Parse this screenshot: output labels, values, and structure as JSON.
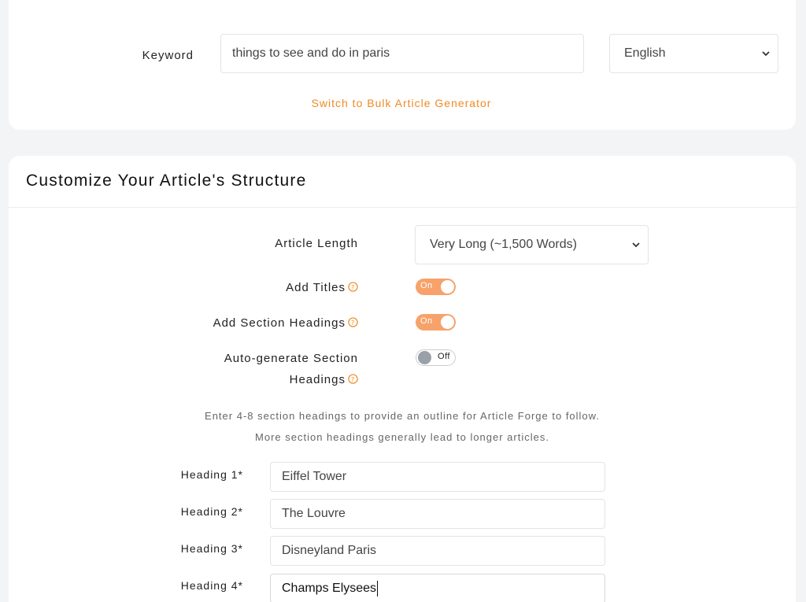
{
  "keyword_section": {
    "label": "Keyword",
    "value": "things to see and do in paris",
    "language": "English",
    "bulk_link": "Switch to Bulk Article Generator"
  },
  "structure": {
    "title": "Customize Your Article's Structure",
    "article_length_label": "Article Length",
    "article_length_value": "Very Long (~1,500 Words)",
    "add_titles_label": "Add Titles",
    "add_titles_state": "On",
    "add_section_headings_label": "Add Section Headings",
    "add_section_headings_state": "On",
    "auto_generate_label_line1": "Auto-generate Section",
    "auto_generate_label_line2": "Headings",
    "auto_generate_state": "Off",
    "hint_line1": "Enter 4-8 section headings to provide an outline for Article Forge to follow.",
    "hint_line2": "More section headings generally lead to longer articles.",
    "headings": [
      {
        "label": "Heading 1*",
        "value": "Eiffel Tower"
      },
      {
        "label": "Heading 2*",
        "value": "The Louvre"
      },
      {
        "label": "Heading 3*",
        "value": "Disneyland Paris"
      },
      {
        "label": "Heading 4*",
        "value": "Champs Elysees"
      }
    ]
  },
  "colors": {
    "accent": "#f08a24",
    "toggle_on": "#f7a26a",
    "toggle_off_knob": "#9aa0a8"
  }
}
